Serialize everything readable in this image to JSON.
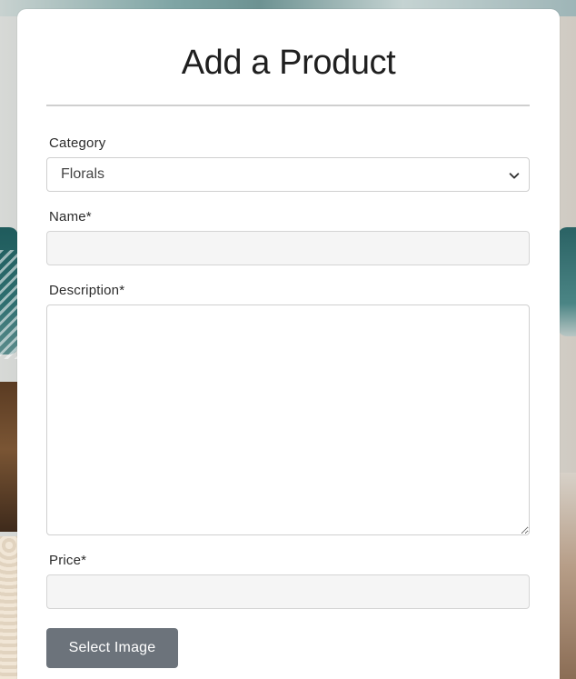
{
  "form": {
    "title": "Add a Product",
    "category": {
      "label": "Category",
      "selected": "Florals"
    },
    "name": {
      "label": "Name*",
      "value": ""
    },
    "description": {
      "label": "Description*",
      "value": ""
    },
    "price": {
      "label": "Price*",
      "value": ""
    },
    "select_image_button": "Select Image"
  }
}
